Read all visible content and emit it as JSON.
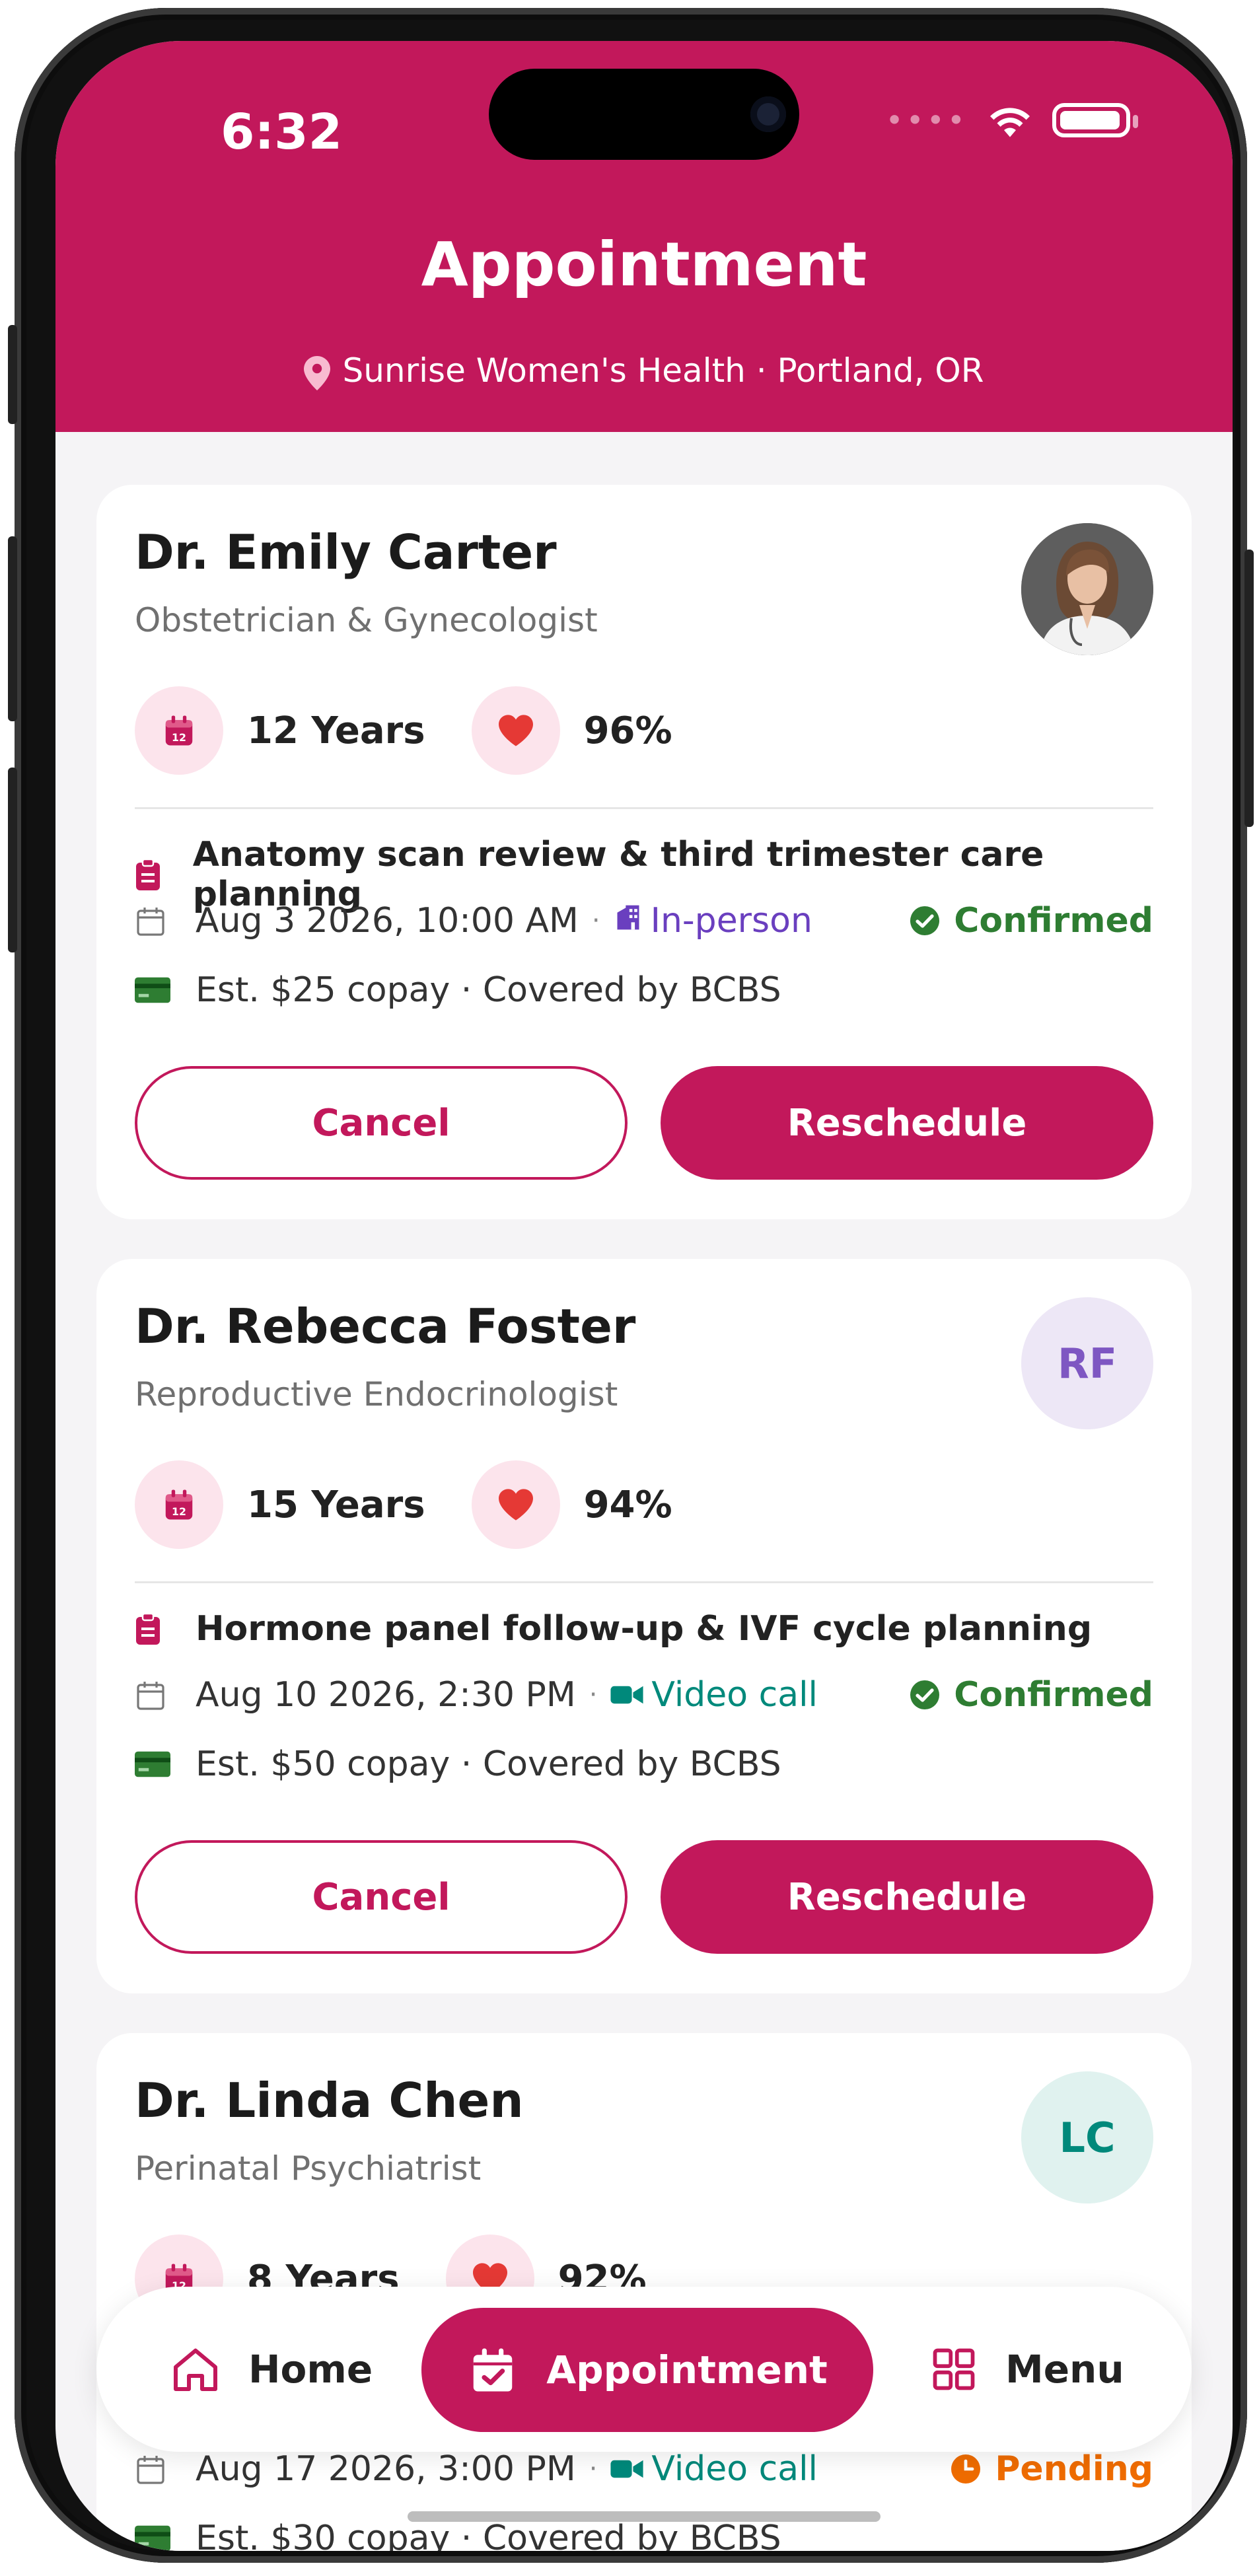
{
  "status_bar": {
    "time": "6:32"
  },
  "header": {
    "title": "Appointment",
    "location": "Sunrise Women's Health · Portland, OR"
  },
  "colors": {
    "brand": "#c2185b",
    "confirmed": "#2e7d32",
    "pending": "#ef6c00",
    "in_person": "#6a3fbf",
    "video": "#00897b"
  },
  "appointments": [
    {
      "doctor": "Dr. Emily Carter",
      "specialty": "Obstetrician & Gynecologist",
      "avatar": "photo",
      "experience": "12 Years",
      "rating": "96%",
      "purpose": "Anatomy scan review & third trimester care planning",
      "datetime": "Aug 3 2026, 10:00 AM",
      "mode": "In-person",
      "mode_icon": "building-icon",
      "status": "Confirmed",
      "copay": "Est. $25 copay · Covered by BCBS",
      "cancel_label": "Cancel",
      "reschedule_label": "Reschedule"
    },
    {
      "doctor": "Dr. Rebecca Foster",
      "specialty": "Reproductive Endocrinologist",
      "avatar_initials": "RF",
      "experience": "15 Years",
      "rating": "94%",
      "purpose": "Hormone panel follow-up & IVF cycle planning",
      "datetime": "Aug 10 2026, 2:30 PM",
      "mode": "Video call",
      "mode_icon": "video-icon",
      "status": "Confirmed",
      "copay": "Est. $50 copay · Covered by BCBS",
      "cancel_label": "Cancel",
      "reschedule_label": "Reschedule"
    },
    {
      "doctor": "Dr. Linda Chen",
      "specialty": "Perinatal Psychiatrist",
      "avatar_initials": "LC",
      "experience": "8 Years",
      "rating": "92%",
      "datetime": "Aug 17 2026, 3:00 PM",
      "mode": "Video call",
      "mode_icon": "video-icon",
      "status": "Pending",
      "copay": "Est. $30 copay · Covered by BCBS"
    }
  ],
  "bottom_nav": {
    "home": "Home",
    "appointment": "Appointment",
    "menu": "Menu"
  }
}
